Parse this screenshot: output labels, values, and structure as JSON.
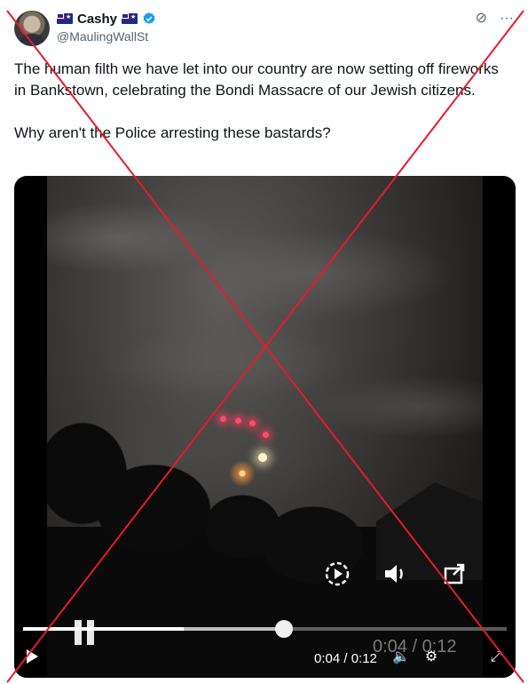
{
  "author": {
    "name": "Cashy",
    "handle": "@MaulingWallSt",
    "verified": true,
    "flag_icons": [
      "australia-flag-icon",
      "australia-flag-icon"
    ]
  },
  "top_icons": [
    "grok-icon",
    "more-icon"
  ],
  "tweet": {
    "text": "The human filth we have let into our country are now setting off fireworks in Bankstown, celebrating the Bondi Massacre of our Jewish citizens.\n\nWhy aren't the Police arresting these bastards?"
  },
  "video": {
    "time_display": "0:04 / 0:12",
    "ghost_time": "0:04 / 0:12",
    "progress": 0.333,
    "buffered": 0.54,
    "overlay_icons": [
      "playback-speed-icon",
      "volume-icon",
      "pop-out-icon"
    ],
    "control_icons": [
      "play-icon",
      "volume-icon",
      "settings-icon",
      "fullscreen-icon"
    ]
  },
  "overlay": {
    "cross_color": "#e8192c"
  },
  "colors": {
    "text": "#0f1419",
    "secondary": "#536471",
    "verified": "#1d9bf0"
  }
}
